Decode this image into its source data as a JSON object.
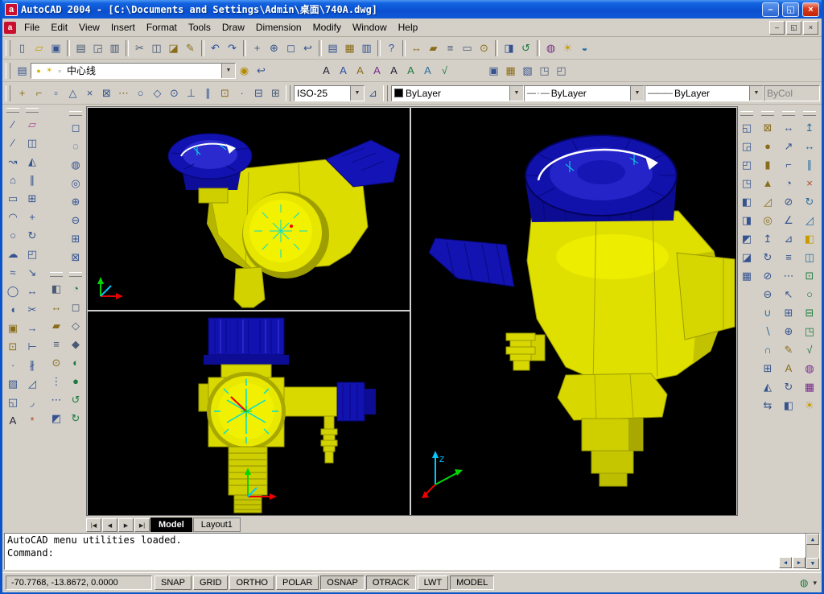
{
  "window": {
    "title": "AutoCAD 2004 - [C:\\Documents and Settings\\Admin\\桌面\\740A.dwg]"
  },
  "glyphs": {
    "app_icon": "a",
    "doc_icon": "a",
    "minimize": "–",
    "restore": "◱",
    "close": "×",
    "combo_arrow": "▼",
    "scroll_up": "▲",
    "scroll_down": "▼",
    "scroll_left": "◀",
    "scroll_right": "▶",
    "tab_first": "|◀",
    "tab_prev": "◀",
    "tab_next": "▶",
    "tab_last": "▶|",
    "status_menu": "▾",
    "comm_center": "◍"
  },
  "menu": {
    "items": [
      "File",
      "Edit",
      "View",
      "Insert",
      "Format",
      "Tools",
      "Draw",
      "Dimension",
      "Modify",
      "Window",
      "Help"
    ]
  },
  "toolbars": {
    "row1": [
      {
        "n": "qnew",
        "g": "▯",
        "c": "#4a5a75"
      },
      {
        "n": "open",
        "g": "▱",
        "c": "#c79a00"
      },
      {
        "n": "save",
        "g": "▣",
        "c": "#35548f"
      },
      {
        "sep": true
      },
      {
        "n": "plot",
        "g": "▤",
        "c": "#4a5a75"
      },
      {
        "n": "plot-preview",
        "g": "◲",
        "c": "#4a5a75"
      },
      {
        "n": "publish",
        "g": "▥",
        "c": "#4a5a75"
      },
      {
        "sep": true
      },
      {
        "n": "cut",
        "g": "✂",
        "c": "#4a5a75"
      },
      {
        "n": "copy-clip",
        "g": "◫",
        "c": "#4a5a75"
      },
      {
        "n": "paste-clip",
        "g": "◪",
        "c": "#8a6d1a"
      },
      {
        "n": "match-properties",
        "g": "✎",
        "c": "#8a6d1a"
      },
      {
        "sep": true
      },
      {
        "n": "undo",
        "g": "↶",
        "c": "#2a4fa0"
      },
      {
        "n": "redo",
        "g": "↷",
        "c": "#2a4fa0"
      },
      {
        "sep": true
      },
      {
        "n": "pan-realtime",
        "g": "+",
        "c": "#4a5a75"
      },
      {
        "n": "zoom-realtime",
        "g": "⊕",
        "c": "#35548f"
      },
      {
        "n": "zoom-window",
        "g": "◻",
        "c": "#35548f"
      },
      {
        "n": "zoom-previous",
        "g": "↩",
        "c": "#35548f"
      },
      {
        "sep": true
      },
      {
        "n": "properties",
        "g": "▤",
        "c": "#35548f"
      },
      {
        "n": "designcenter",
        "g": "▦",
        "c": "#8a6d1a"
      },
      {
        "n": "tool-palettes",
        "g": "▥",
        "c": "#35548f"
      },
      {
        "sep": true
      },
      {
        "n": "help",
        "g": "?",
        "c": "#2a4fa0"
      },
      {
        "sep": true
      },
      {
        "n": "distance",
        "g": "↔",
        "c": "#8a6d1a"
      },
      {
        "n": "area",
        "g": "▰",
        "c": "#8a6d1a"
      },
      {
        "n": "mass-properties",
        "g": "≡",
        "c": "#4a5a75"
      },
      {
        "n": "list",
        "g": "▭",
        "c": "#4a5a75"
      },
      {
        "n": "locate-point",
        "g": "⊙",
        "c": "#8a6d1a"
      },
      {
        "sep": true
      },
      {
        "n": "named-views",
        "g": "◨",
        "c": "#35548f"
      },
      {
        "n": "3d-orbit",
        "g": "↺",
        "c": "#1d7a3d"
      },
      {
        "sep": true
      },
      {
        "n": "render",
        "g": "◍",
        "c": "#7a2a8a"
      },
      {
        "n": "lights",
        "g": "☀",
        "c": "#c79a00"
      },
      {
        "n": "materials",
        "g": "◒",
        "c": "#2a6fa0"
      }
    ],
    "row2": {
      "pre": [
        {
          "n": "layer-properties-manager",
          "g": "▤",
          "c": "#35548f"
        }
      ],
      "layer_combo": {
        "icons": [
          {
            "n": "layer-bulb",
            "g": "●",
            "c": "#d8b400"
          },
          {
            "n": "layer-sun",
            "g": "☀",
            "c": "#d8b400"
          },
          {
            "n": "layer-color",
            "g": "▫",
            "c": "#555555"
          }
        ],
        "value": "中心线"
      },
      "post": [
        {
          "n": "make-object-layer-current",
          "g": "◉",
          "c": "#b58a00"
        },
        {
          "n": "layer-previous",
          "g": "↩",
          "c": "#35548f"
        }
      ],
      "text_group": [
        {
          "n": "multiline-text",
          "g": "A",
          "c": "#222233"
        },
        {
          "n": "single-line-text",
          "g": "A",
          "c": "#2a4fa0"
        },
        {
          "n": "edit-text",
          "g": "A",
          "c": "#8a6d1a"
        },
        {
          "n": "find-replace",
          "g": "A",
          "c": "#7a2a8a"
        },
        {
          "n": "text-style",
          "g": "A",
          "c": "#222233"
        },
        {
          "n": "scale-text",
          "g": "A",
          "c": "#1d7a3d"
        },
        {
          "n": "justify-text",
          "g": "A",
          "c": "#2a6fa0"
        },
        {
          "n": "spell-check",
          "g": "√",
          "c": "#1d7a3d"
        }
      ],
      "insert_group": [
        {
          "n": "insert-block",
          "g": "▣",
          "c": "#35548f"
        },
        {
          "n": "external-reference",
          "g": "▦",
          "c": "#8a6d1a"
        },
        {
          "n": "image-attach",
          "g": "▧",
          "c": "#35548f"
        },
        {
          "n": "import",
          "g": "◳",
          "c": "#4a5a75"
        },
        {
          "n": "ole-object",
          "g": "◰",
          "c": "#4a5a75"
        }
      ]
    },
    "row3": {
      "osnap": [
        {
          "n": "temporary-track-point",
          "g": "+",
          "c": "#8a6d1a"
        },
        {
          "n": "snap-from",
          "g": "⌐",
          "c": "#8a6d1a"
        },
        {
          "n": "snap-endpoint",
          "g": "▫",
          "c": "#35548f"
        },
        {
          "n": "snap-midpoint",
          "g": "△",
          "c": "#35548f"
        },
        {
          "n": "snap-intersection",
          "g": "×",
          "c": "#35548f"
        },
        {
          "n": "snap-apparent-intersection",
          "g": "⊠",
          "c": "#35548f"
        },
        {
          "n": "snap-extension",
          "g": "⋯",
          "c": "#8a6d1a"
        },
        {
          "n": "snap-center",
          "g": "○",
          "c": "#35548f"
        },
        {
          "n": "snap-quadrant",
          "g": "◇",
          "c": "#35548f"
        },
        {
          "n": "snap-tangent",
          "g": "⊙",
          "c": "#35548f"
        },
        {
          "n": "snap-perpendicular",
          "g": "⊥",
          "c": "#35548f"
        },
        {
          "n": "snap-parallel",
          "g": "∥",
          "c": "#35548f"
        },
        {
          "n": "snap-insert",
          "g": "⊡",
          "c": "#8a6d1a"
        },
        {
          "n": "snap-node",
          "g": "∙",
          "c": "#35548f"
        },
        {
          "n": "snap-nearest",
          "g": "⊟",
          "c": "#35548f"
        },
        {
          "n": "osnap-settings",
          "g": "⊞",
          "c": "#4a5a75"
        }
      ],
      "style_combo": {
        "value": "ISO-25"
      },
      "post_style": [
        {
          "n": "dimension-style",
          "g": "⊿",
          "c": "#35548f"
        }
      ],
      "color_combo": {
        "value": "ByLayer",
        "swatch": "#000000"
      },
      "linetype_combo": {
        "pattern": "— · —",
        "value": "ByLayer"
      },
      "lineweight_combo": {
        "pattern": "———",
        "value": "ByLayer"
      },
      "plotstyle_combo": {
        "value": "ByCol"
      }
    }
  },
  "left_toolbars": {
    "draw": [
      {
        "n": "line",
        "g": "∕",
        "c": "#35548f"
      },
      {
        "n": "construction-line",
        "g": "⁄",
        "c": "#35548f"
      },
      {
        "n": "polyline",
        "g": "↝",
        "c": "#35548f"
      },
      {
        "n": "polygon",
        "g": "⌂",
        "c": "#35548f"
      },
      {
        "n": "rectangle",
        "g": "▭",
        "c": "#35548f"
      },
      {
        "n": "arc",
        "g": "◠",
        "c": "#35548f"
      },
      {
        "n": "circle",
        "g": "○",
        "c": "#35548f"
      },
      {
        "n": "revision-cloud",
        "g": "☁",
        "c": "#35548f"
      },
      {
        "n": "spline",
        "g": "≈",
        "c": "#35548f"
      },
      {
        "n": "ellipse",
        "g": "◯",
        "c": "#35548f"
      },
      {
        "n": "ellipse-arc",
        "g": "◖",
        "c": "#35548f"
      },
      {
        "n": "insert-block",
        "g": "▣",
        "c": "#8a6d1a"
      },
      {
        "n": "make-block",
        "g": "⊡",
        "c": "#8a6d1a"
      },
      {
        "n": "point",
        "g": "∙",
        "c": "#35548f"
      },
      {
        "n": "hatch",
        "g": "▨",
        "c": "#35548f"
      },
      {
        "n": "region",
        "g": "◱",
        "c": "#35548f"
      },
      {
        "n": "multiline-text",
        "g": "A",
        "c": "#222233"
      }
    ],
    "modify": [
      {
        "n": "erase",
        "g": "▱",
        "c": "#b04a8a"
      },
      {
        "n": "copy-object",
        "g": "◫",
        "c": "#35548f"
      },
      {
        "n": "mirror",
        "g": "◭",
        "c": "#35548f"
      },
      {
        "n": "offset",
        "g": "∥",
        "c": "#35548f"
      },
      {
        "n": "array",
        "g": "⊞",
        "c": "#35548f"
      },
      {
        "n": "move",
        "g": "+",
        "c": "#35548f"
      },
      {
        "n": "rotate",
        "g": "↻",
        "c": "#35548f"
      },
      {
        "n": "scale",
        "g": "◰",
        "c": "#35548f"
      },
      {
        "n": "stretch",
        "g": "↘",
        "c": "#35548f"
      },
      {
        "n": "lengthen",
        "g": "↔",
        "c": "#35548f"
      },
      {
        "n": "trim",
        "g": "✂",
        "c": "#35548f"
      },
      {
        "n": "extend",
        "g": "→",
        "c": "#35548f"
      },
      {
        "n": "break-at-point",
        "g": "⊢",
        "c": "#35548f"
      },
      {
        "n": "break",
        "g": "∦",
        "c": "#35548f"
      },
      {
        "n": "chamfer",
        "g": "◿",
        "c": "#35548f"
      },
      {
        "n": "fillet",
        "g": "◞",
        "c": "#35548f"
      },
      {
        "n": "explode",
        "g": "*",
        "c": "#b04a2a"
      }
    ],
    "zoom": [
      {
        "n": "zoom-window",
        "g": "◻",
        "c": "#35548f"
      },
      {
        "n": "zoom-dynamic",
        "g": "◌",
        "c": "#35548f"
      },
      {
        "n": "zoom-scale",
        "g": "◍",
        "c": "#35548f"
      },
      {
        "n": "zoom-center",
        "g": "◎",
        "c": "#35548f"
      },
      {
        "n": "zoom-in",
        "g": "⊕",
        "c": "#35548f"
      },
      {
        "n": "zoom-out",
        "g": "⊖",
        "c": "#35548f"
      },
      {
        "n": "zoom-all",
        "g": "⊞",
        "c": "#35548f"
      },
      {
        "n": "zoom-extents",
        "g": "⊠",
        "c": "#35548f"
      }
    ],
    "inquiry": [
      {
        "n": "draworder",
        "g": "◧",
        "c": "#4a5a75"
      },
      {
        "n": "distance",
        "g": "↔",
        "c": "#8a6d1a"
      },
      {
        "n": "area",
        "g": "▰",
        "c": "#8a6d1a"
      },
      {
        "n": "list",
        "g": "≡",
        "c": "#4a5a75"
      },
      {
        "n": "id-point",
        "g": "⊙",
        "c": "#8a6d1a"
      },
      {
        "n": "divide",
        "g": "⋮",
        "c": "#35548f"
      },
      {
        "n": "measure",
        "g": "⋯",
        "c": "#35548f"
      },
      {
        "n": "quick-select",
        "g": "◩",
        "c": "#35548f"
      }
    ],
    "shade": [
      {
        "n": "hide",
        "g": "◔",
        "c": "#1d7a3d"
      },
      {
        "n": "2d-wireframe",
        "g": "◻",
        "c": "#4a5a75"
      },
      {
        "n": "3d-wireframe",
        "g": "◇",
        "c": "#4a5a75"
      },
      {
        "n": "hidden-shade",
        "g": "◆",
        "c": "#4a5a75"
      },
      {
        "n": "flat-shaded",
        "g": "◐",
        "c": "#1d7a3d"
      },
      {
        "n": "gouraud-shaded",
        "g": "●",
        "c": "#1d7a3d"
      },
      {
        "n": "3d-orbit",
        "g": "↺",
        "c": "#1d7a3d"
      },
      {
        "n": "3d-continuous-orbit",
        "g": "↻",
        "c": "#1d7a3d"
      }
    ]
  },
  "right_toolbars": {
    "views": [
      {
        "n": "top-view",
        "g": "◱",
        "c": "#35548f"
      },
      {
        "n": "bottom-view",
        "g": "◲",
        "c": "#35548f"
      },
      {
        "n": "left-view",
        "g": "◰",
        "c": "#35548f"
      },
      {
        "n": "right-view",
        "g": "◳",
        "c": "#35548f"
      },
      {
        "n": "front-view",
        "g": "◧",
        "c": "#35548f"
      },
      {
        "n": "back-view",
        "g": "◨",
        "c": "#35548f"
      },
      {
        "n": "sw-isometric-view",
        "g": "◩",
        "c": "#35548f"
      },
      {
        "n": "se-isometric-view",
        "g": "◪",
        "c": "#35548f"
      },
      {
        "n": "named-views",
        "g": "▦",
        "c": "#35548f"
      }
    ],
    "solids": [
      {
        "n": "solid-box",
        "g": "⊠",
        "c": "#8a6d1a"
      },
      {
        "n": "solid-sphere",
        "g": "●",
        "c": "#8a6d1a"
      },
      {
        "n": "solid-cylinder",
        "g": "▮",
        "c": "#8a6d1a"
      },
      {
        "n": "solid-cone",
        "g": "▲",
        "c": "#8a6d1a"
      },
      {
        "n": "solid-wedge",
        "g": "◿",
        "c": "#8a6d1a"
      },
      {
        "n": "solid-torus",
        "g": "◎",
        "c": "#8a6d1a"
      },
      {
        "n": "extrude",
        "g": "↥",
        "c": "#35548f"
      },
      {
        "n": "revolve",
        "g": "↻",
        "c": "#35548f"
      },
      {
        "n": "slice",
        "g": "⊘",
        "c": "#35548f"
      },
      {
        "n": "section",
        "g": "⊖",
        "c": "#35548f"
      },
      {
        "n": "union",
        "g": "∪",
        "c": "#2a6fa0"
      },
      {
        "n": "subtract",
        "g": "∖",
        "c": "#2a6fa0"
      },
      {
        "n": "intersect",
        "g": "∩",
        "c": "#2a6fa0"
      },
      {
        "n": "3d-array",
        "g": "⊞",
        "c": "#35548f"
      },
      {
        "n": "mirror-3d",
        "g": "◭",
        "c": "#35548f"
      },
      {
        "n": "align",
        "g": "⇆",
        "c": "#35548f"
      }
    ],
    "dimension": [
      {
        "n": "linear-dimension",
        "g": "↔",
        "c": "#35548f"
      },
      {
        "n": "aligned-dimension",
        "g": "↗",
        "c": "#35548f"
      },
      {
        "n": "ordinate-dimension",
        "g": "⌐",
        "c": "#35548f"
      },
      {
        "n": "radius-dimension",
        "g": "◔",
        "c": "#35548f"
      },
      {
        "n": "diameter-dimension",
        "g": "⊘",
        "c": "#35548f"
      },
      {
        "n": "angular-dimension",
        "g": "∠",
        "c": "#35548f"
      },
      {
        "n": "quick-dimension",
        "g": "⊿",
        "c": "#35548f"
      },
      {
        "n": "baseline-dimension",
        "g": "≡",
        "c": "#35548f"
      },
      {
        "n": "continue-dimension",
        "g": "⋯",
        "c": "#35548f"
      },
      {
        "n": "quick-leader",
        "g": "↖",
        "c": "#35548f"
      },
      {
        "n": "tolerance",
        "g": "⊞",
        "c": "#35548f"
      },
      {
        "n": "center-mark",
        "g": "⊕",
        "c": "#35548f"
      },
      {
        "n": "dimension-edit",
        "g": "✎",
        "c": "#8a6d1a"
      },
      {
        "n": "dimension-text-edit",
        "g": "A",
        "c": "#8a6d1a"
      },
      {
        "n": "dimension-update",
        "g": "↻",
        "c": "#35548f"
      },
      {
        "n": "dim-style-manager",
        "g": "◧",
        "c": "#35548f"
      }
    ],
    "solids_editing": [
      {
        "n": "extrude-faces",
        "g": "↥",
        "c": "#2a6fa0"
      },
      {
        "n": "move-faces",
        "g": "↔",
        "c": "#2a6fa0"
      },
      {
        "n": "offset-faces",
        "g": "∥",
        "c": "#2a6fa0"
      },
      {
        "n": "delete-faces",
        "g": "×",
        "c": "#b04a2a"
      },
      {
        "n": "rotate-faces",
        "g": "↻",
        "c": "#2a6fa0"
      },
      {
        "n": "taper-faces",
        "g": "◿",
        "c": "#2a6fa0"
      },
      {
        "n": "color-faces",
        "g": "◧",
        "c": "#c79a00"
      },
      {
        "n": "copy-faces",
        "g": "◫",
        "c": "#2a6fa0"
      },
      {
        "n": "imprint",
        "g": "⊡",
        "c": "#1d7a3d"
      },
      {
        "n": "clean",
        "g": "○",
        "c": "#1d7a3d"
      },
      {
        "n": "separate",
        "g": "⊟",
        "c": "#1d7a3d"
      },
      {
        "n": "shell",
        "g": "◳",
        "c": "#1d7a3d"
      },
      {
        "n": "check",
        "g": "√",
        "c": "#1d7a3d"
      },
      {
        "n": "render",
        "g": "◍",
        "c": "#7a2a8a"
      },
      {
        "n": "scene",
        "g": "▦",
        "c": "#7a2a8a"
      },
      {
        "n": "light",
        "g": "☀",
        "c": "#c79a00"
      }
    ]
  },
  "tabs": {
    "items": [
      {
        "label": "Model",
        "active": true
      },
      {
        "label": "Layout1",
        "active": false
      }
    ]
  },
  "command": {
    "lines": [
      "AutoCAD menu utilities loaded.",
      "Command:"
    ]
  },
  "statusbar": {
    "coords": "-70.7768, -13.8672, 0.0000",
    "toggles": [
      {
        "label": "SNAP",
        "pressed": false
      },
      {
        "label": "GRID",
        "pressed": false
      },
      {
        "label": "ORTHO",
        "pressed": false
      },
      {
        "label": "POLAR",
        "pressed": false
      },
      {
        "label": "OSNAP",
        "pressed": true
      },
      {
        "label": "OTRACK",
        "pressed": true
      },
      {
        "label": "LWT",
        "pressed": false
      },
      {
        "label": "MODEL",
        "pressed": true
      }
    ]
  }
}
